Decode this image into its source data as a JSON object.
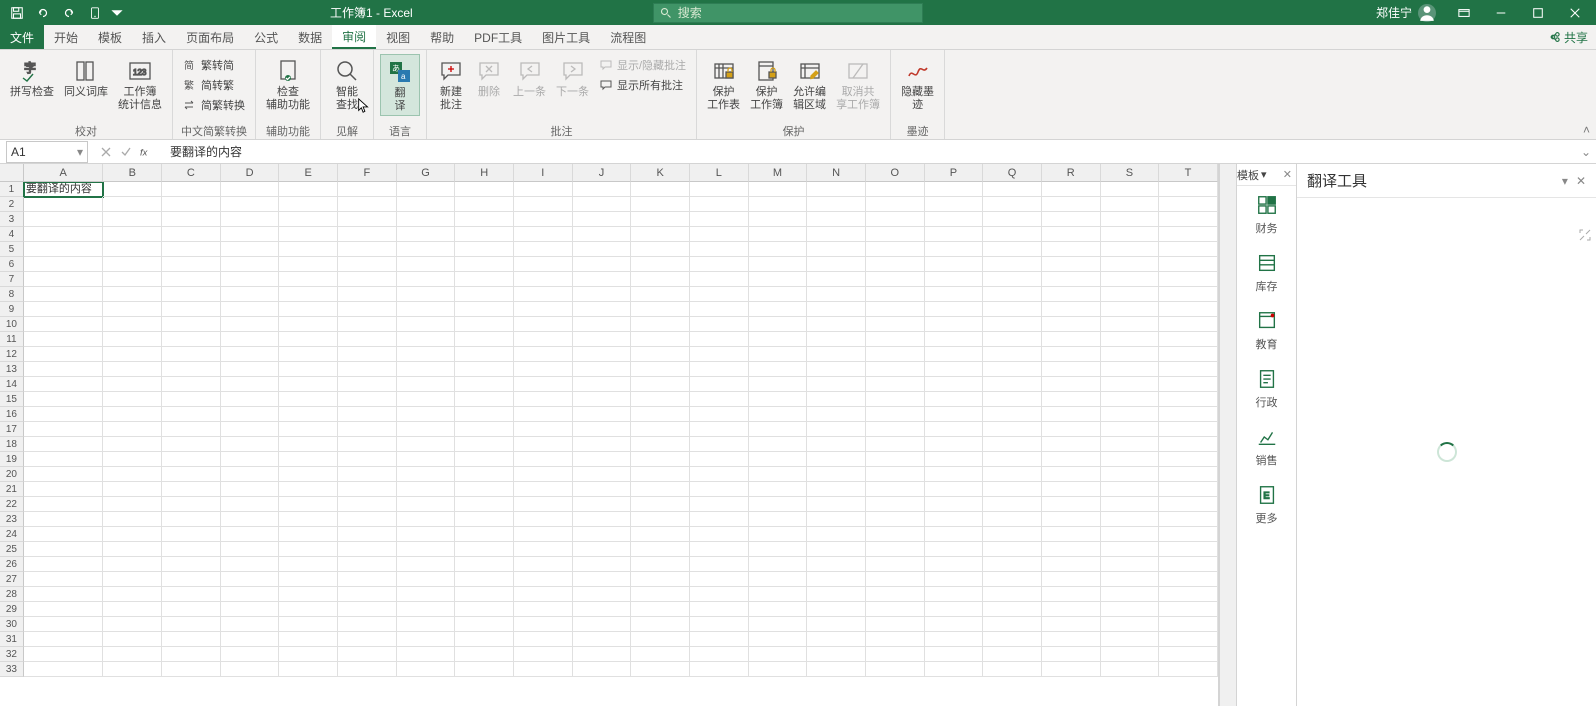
{
  "title": {
    "doc": "工作簿1",
    "sep": " - ",
    "app": "Excel"
  },
  "search": {
    "placeholder": "搜索"
  },
  "user": {
    "name": "郑佳宁"
  },
  "tabs": {
    "file": "文件",
    "home": "开始",
    "template": "模板",
    "insert": "插入",
    "layout": "页面布局",
    "formulas": "公式",
    "data": "数据",
    "review": "审阅",
    "view": "视图",
    "help": "帮助",
    "pdf": "PDF工具",
    "pic": "图片工具",
    "flow": "流程图"
  },
  "share": "共享",
  "ribbon": {
    "proof": {
      "label": "校对",
      "spell": "拼写检查",
      "thes": "同义词库",
      "stats": "工作簿\n统计信息"
    },
    "cjk": {
      "label": "中文简繁转换",
      "t2s": "繁转简",
      "s2t": "简转繁",
      "conv": "简繁转换"
    },
    "acc": {
      "label": "辅助功能",
      "check": "检查\n辅助功能"
    },
    "insight": {
      "label": "见解",
      "smart": "智能\n查找"
    },
    "lang": {
      "label": "语言",
      "trans": "翻\n译"
    },
    "comments": {
      "label": "批注",
      "new": "新建\n批注",
      "del": "删除",
      "prev": "上一条",
      "next": "下一条",
      "toggle": "显示/隐藏批注",
      "showall": "显示所有批注"
    },
    "protect": {
      "label": "保护",
      "sheet": "保护\n工作表",
      "book": "保护\n工作簿",
      "range": "允许编\n辑区域",
      "unshare": "取消共\n享工作簿"
    },
    "ink": {
      "label": "墨迹",
      "hide": "隐藏墨\n迹"
    }
  },
  "namebox": "A1",
  "formula": "要翻译的内容",
  "cellA1": "要翻译的内容",
  "columns": [
    "A",
    "B",
    "C",
    "D",
    "E",
    "F",
    "G",
    "H",
    "I",
    "J",
    "K",
    "L",
    "M",
    "N",
    "O",
    "P",
    "Q",
    "R",
    "S",
    "T"
  ],
  "rows_count": 33,
  "tpl": {
    "title": "模板",
    "fin": "财务",
    "inv": "库存",
    "edu": "教育",
    "adm": "行政",
    "sale": "销售",
    "more": "更多"
  },
  "trans": {
    "title": "翻译工具"
  }
}
